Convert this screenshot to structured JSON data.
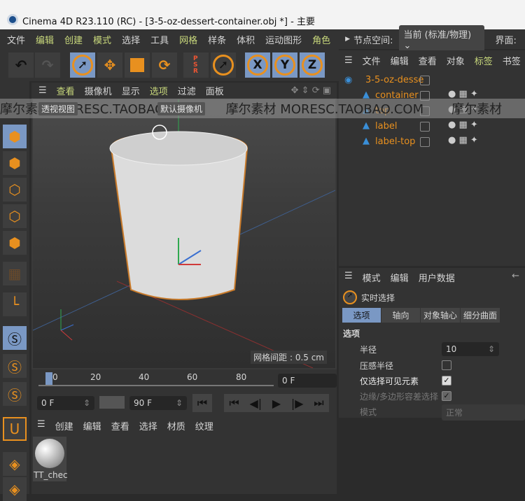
{
  "window": {
    "title": "Cinema 4D R23.110 (RC) - [3-5-oz-dessert-container.obj *] - 主要"
  },
  "menu": {
    "items": [
      {
        "label": "文件",
        "hl": false
      },
      {
        "label": "编辑",
        "hl": true
      },
      {
        "label": "创建",
        "hl": true
      },
      {
        "label": "模式",
        "hl": true
      },
      {
        "label": "选择",
        "hl": false
      },
      {
        "label": "工具",
        "hl": false
      },
      {
        "label": "网格",
        "hl": true
      },
      {
        "label": "样条",
        "hl": false
      },
      {
        "label": "体积",
        "hl": false
      },
      {
        "label": "运动图形",
        "hl": false
      },
      {
        "label": "角色",
        "hl": true
      }
    ],
    "node_space_label": "节点空间:",
    "node_space_value": "当前 (标准/物理)",
    "interface_label": "界面:"
  },
  "toolbar": {
    "psr": "PSR",
    "x": "X",
    "y": "Y",
    "z": "Z"
  },
  "viewport": {
    "menu": [
      "查看",
      "摄像机",
      "显示",
      "选项",
      "过滤",
      "面板"
    ],
    "view_name": "透视视图",
    "camera": "默认摄像机",
    "grid_spacing": "网格间距 : 0.5 cm"
  },
  "object_manager": {
    "menu": [
      "文件",
      "编辑",
      "查看",
      "对象",
      "标签",
      "书签"
    ],
    "objects": [
      "3-5-oz-desse",
      "container",
      "top",
      "label",
      "label-top"
    ]
  },
  "attribute_manager": {
    "menu": [
      "模式",
      "编辑",
      "用户数据"
    ],
    "tool": "实时选择",
    "tabs": [
      "选项",
      "轴向",
      "对象轴心",
      "细分曲面"
    ],
    "section": "选项",
    "radius_label": "半径",
    "radius_value": "10",
    "pressure_label": "压感半径",
    "pressure": false,
    "visible_only_label": "仅选择可见元素",
    "visible_only": true,
    "tolerance_label": "边缘/多边形容差选择",
    "tolerance": true,
    "mode_label": "模式",
    "mode_value": "正常"
  },
  "timeline": {
    "ticks": [
      "0",
      "20",
      "40",
      "60",
      "80"
    ],
    "current_frame": "0 F",
    "start": "0 F",
    "end": "90 F"
  },
  "material_manager": {
    "menu": [
      "创建",
      "编辑",
      "查看",
      "选择",
      "材质",
      "纹理"
    ],
    "materials": [
      "TT_chec"
    ]
  },
  "watermark": [
    "摩尔素材 MORESC.TAOBAO.COM",
    "摩尔素材 MORESC.TAOBAO.COM",
    "摩尔素材"
  ],
  "colors": {
    "accent": "#e8901f",
    "selected": "#7a98c4",
    "highlight_menu": "#c9d97c"
  }
}
